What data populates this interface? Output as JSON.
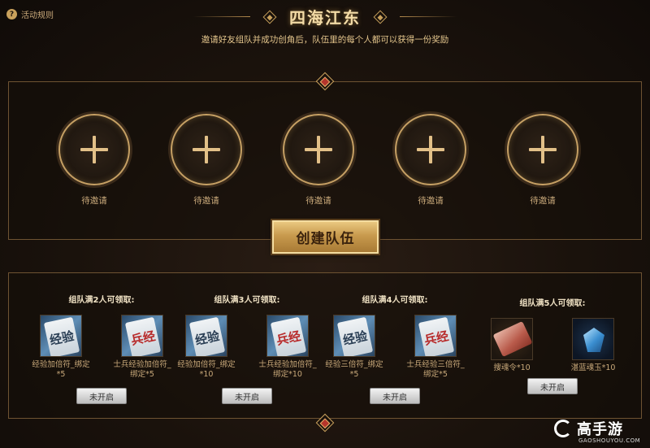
{
  "header": {
    "rules_label": "活动规则",
    "title": "四海江东",
    "subtitle": "邀请好友组队并成功创角后，队伍里的每个人都可以获得一份奖励"
  },
  "team": {
    "slots": [
      {
        "label": "待邀请"
      },
      {
        "label": "待邀请"
      },
      {
        "label": "待邀请"
      },
      {
        "label": "待邀请"
      },
      {
        "label": "待邀请"
      }
    ],
    "create_button": "创建队伍"
  },
  "rewards": [
    {
      "title": "组队满2人可领取:",
      "items": [
        {
          "icon": "exp-talisman-icon",
          "name": "经验加倍符_绑定*5"
        },
        {
          "icon": "soldier-exp-talisman-icon",
          "name": "士兵经验加倍符_绑定*5"
        }
      ],
      "button": "未开启"
    },
    {
      "title": "组队满3人可领取:",
      "items": [
        {
          "icon": "exp-talisman-icon",
          "name": "经验加倍符_绑定*10"
        },
        {
          "icon": "soldier-exp-talisman-icon",
          "name": "士兵经验加倍符_绑定*10"
        }
      ],
      "button": "未开启"
    },
    {
      "title": "组队满4人可领取:",
      "items": [
        {
          "icon": "exp-talisman-icon",
          "name": "经验三倍符_绑定*5"
        },
        {
          "icon": "soldier-exp-talisman-icon",
          "name": "士兵经验三倍符_绑定*5"
        }
      ],
      "button": "未开启"
    },
    {
      "title": "组队满5人可领取:",
      "items": [
        {
          "icon": "soul-search-order-icon",
          "name": "搜魂令*10"
        },
        {
          "icon": "blue-soul-jade-icon",
          "name": "湛蓝魂玉*10"
        }
      ],
      "button": "未开启"
    }
  ],
  "card_glyphs": {
    "exp": "经验",
    "soldier": "兵经"
  },
  "watermark": {
    "brand": "高手游",
    "url": "GAOSHOUYOU.COM"
  },
  "colors": {
    "accent_gold": "#c9a15c",
    "title_gold": "#f3dba6",
    "text_tan": "#c9a97a",
    "bg_dark": "#1a120c"
  }
}
